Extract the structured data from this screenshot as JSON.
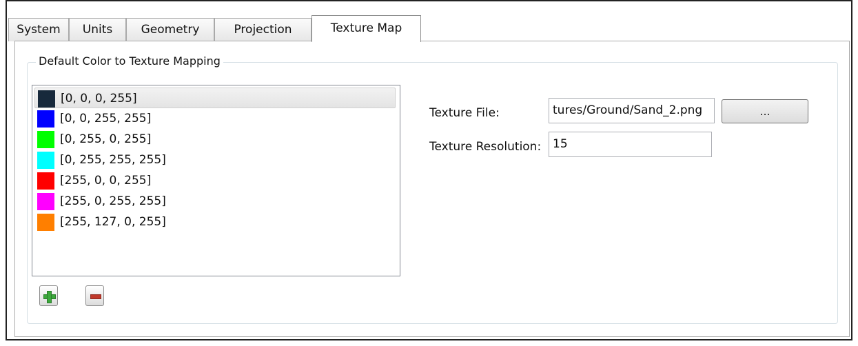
{
  "tabs": [
    {
      "label": "System"
    },
    {
      "label": "Units"
    },
    {
      "label": "Geometry"
    },
    {
      "label": "Projection"
    },
    {
      "label": "Texture Map",
      "active": true
    }
  ],
  "group": {
    "title": "Default Color to Texture Mapping"
  },
  "color_list": [
    {
      "label": "[0, 0, 0, 255]",
      "color": "#17293c",
      "selected": true
    },
    {
      "label": "[0, 0, 255, 255]",
      "color": "#0000ff"
    },
    {
      "label": "[0, 255, 0, 255]",
      "color": "#00ff00"
    },
    {
      "label": "[0, 255, 255, 255]",
      "color": "#00ffff"
    },
    {
      "label": "[255, 0, 0, 255]",
      "color": "#ff0000"
    },
    {
      "label": "[255, 0, 255, 255]",
      "color": "#ff00ff"
    },
    {
      "label": "[255, 127, 0, 255]",
      "color": "#ff7f00"
    }
  ],
  "buttons": {
    "add_icon": "plus-icon",
    "remove_icon": "minus-icon",
    "browse_label": "..."
  },
  "form": {
    "texture_file_label": "Texture File:",
    "texture_file_value": "tures/Ground/Sand_2.png",
    "texture_resolution_label": "Texture Resolution:",
    "texture_resolution_value": "15"
  }
}
